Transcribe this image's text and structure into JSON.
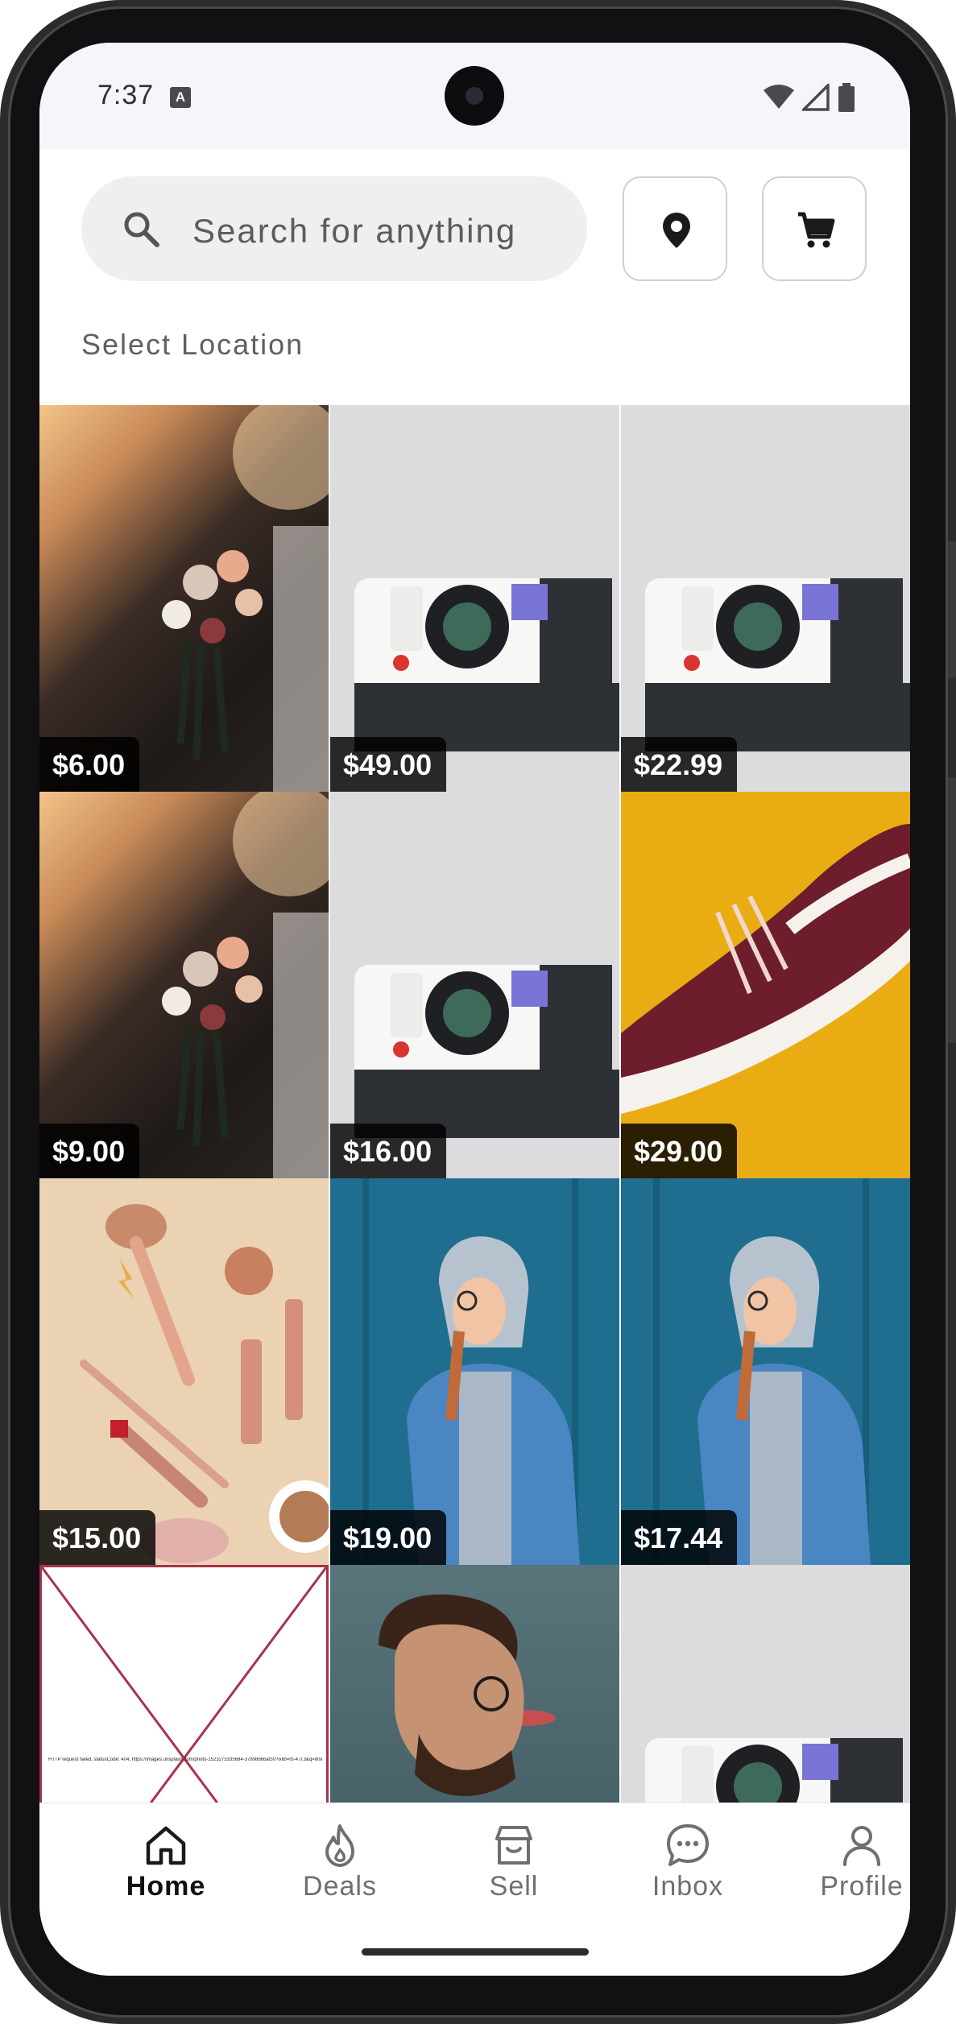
{
  "status_bar": {
    "time": "7:37",
    "notification_badge": "A",
    "icons": [
      "wifi-icon",
      "signal-icon",
      "battery-icon"
    ]
  },
  "header": {
    "search": {
      "placeholder": "Search for anything",
      "icon": "search-icon"
    },
    "location_button_icon": "location-pin-icon",
    "cart_button_icon": "cart-icon",
    "select_location_label": "Select Location"
  },
  "listings": [
    {
      "image": "bouquet",
      "price": "$6.00"
    },
    {
      "image": "instant-camera",
      "price": "$49.00"
    },
    {
      "image": "instant-camera",
      "price": "$22.99"
    },
    {
      "image": "bouquet",
      "price": "$9.00"
    },
    {
      "image": "instant-camera",
      "price": "$16.00"
    },
    {
      "image": "sneaker",
      "price": "$29.00"
    },
    {
      "image": "makeup",
      "price": "$15.00"
    },
    {
      "image": "denim-jacket-woman",
      "price": "$19.00"
    },
    {
      "image": "denim-jacket-woman",
      "price": "$17.44"
    },
    {
      "image": "broken-image",
      "price": "",
      "error_text": "HTTP request failed, statusCode: 404, https://images.unsplash.com/photo-1523275335684-37898b6baf30?ixlib=rb-4.0.3&q=80&w=400&h=400&fit=crop"
    },
    {
      "image": "man-glasses",
      "price": ""
    },
    {
      "image": "instant-camera",
      "price": ""
    }
  ],
  "bottom_nav": {
    "items": [
      {
        "label": "Home",
        "icon": "home-icon",
        "active": true
      },
      {
        "label": "Deals",
        "icon": "flame-icon",
        "active": false
      },
      {
        "label": "Sell",
        "icon": "store-icon",
        "active": false
      },
      {
        "label": "Inbox",
        "icon": "chat-icon",
        "active": false
      },
      {
        "label": "Profile",
        "icon": "person-icon",
        "active": false
      }
    ]
  },
  "colors": {
    "status_bar_bg": "#f5f6fb",
    "search_bg": "#efefef",
    "price_tag_bg": "#000000",
    "broken_image_border": "#a83249"
  }
}
